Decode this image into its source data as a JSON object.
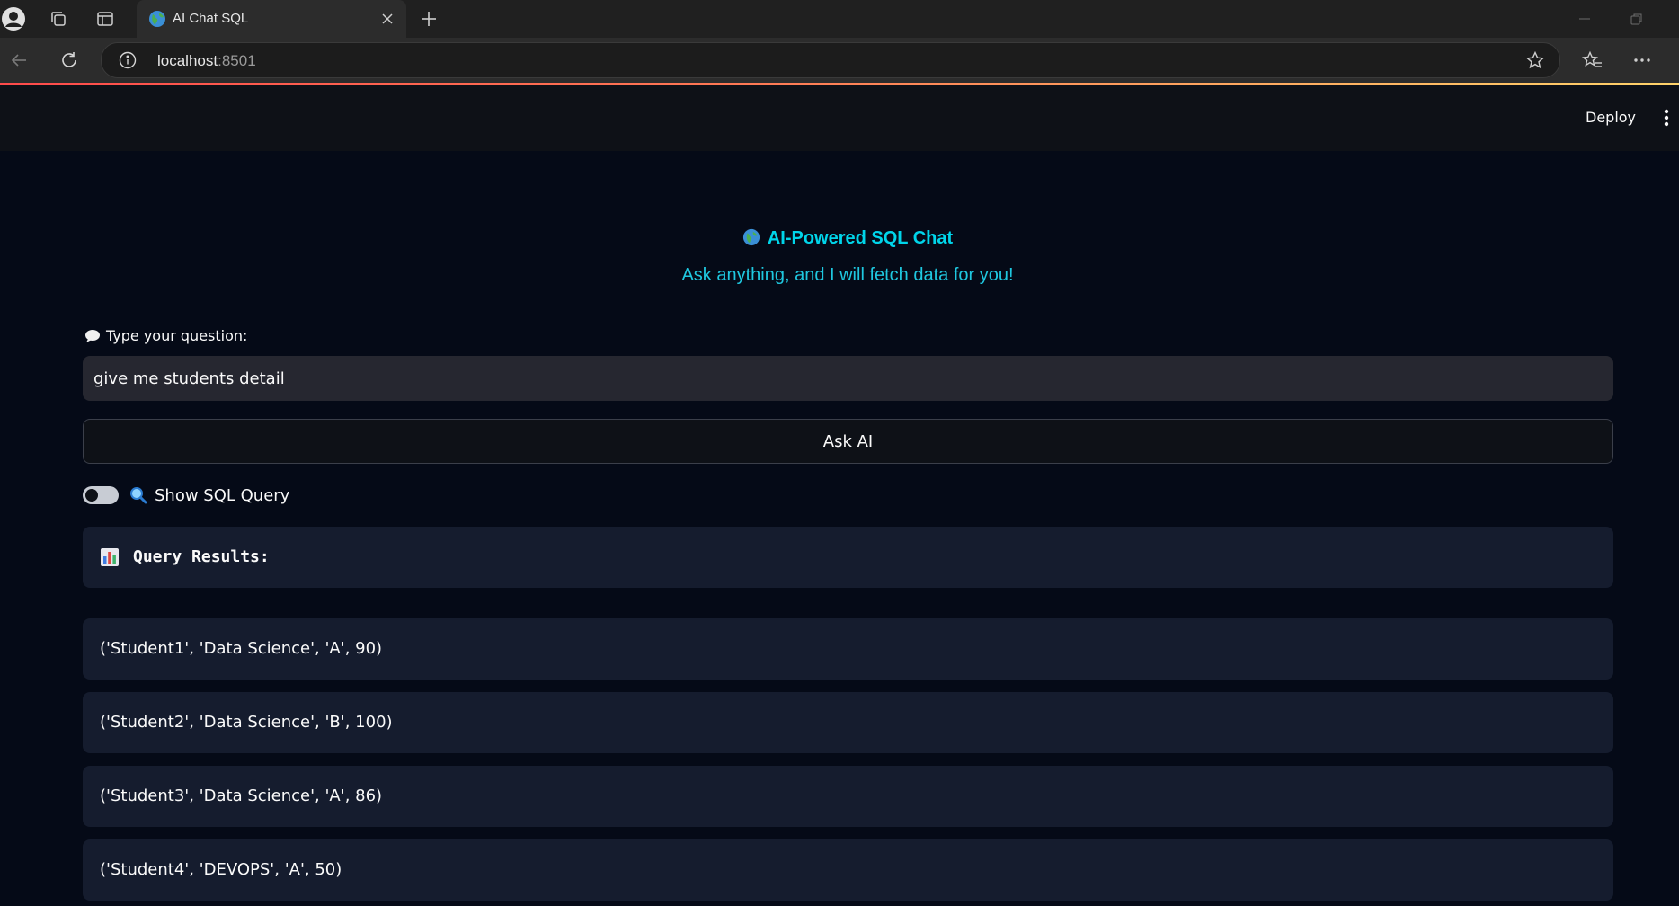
{
  "browser": {
    "tab_title": "AI Chat SQL",
    "url_host": "localhost",
    "url_port": ":8501"
  },
  "header": {
    "deploy_label": "Deploy"
  },
  "app": {
    "title": "AI-Powered SQL Chat",
    "subtitle": "Ask anything, and I will fetch data for you!",
    "question_label": "Type your question:",
    "question_value": "give me students detail",
    "ask_button": "Ask AI",
    "toggle_label": "Show SQL Query",
    "toggle_on": false,
    "results_header": "Query Results:",
    "results": [
      "('Student1', 'Data Science', 'A', 90)",
      "('Student2', 'Data Science', 'B', 100)",
      "('Student3', 'Data Science', 'A', 86)",
      "('Student4', 'DEVOPS', 'A', 50)"
    ]
  },
  "colors": {
    "accent_title": "#00d5ea",
    "background": "#050a17",
    "card": "#151c2e"
  },
  "icons": [
    "profile-icon",
    "collections-icon",
    "tab-actions-icon",
    "globe-icon",
    "close-icon",
    "new-tab-icon",
    "back-icon",
    "refresh-icon",
    "info-icon",
    "star-icon",
    "favorites-icon",
    "more-icon",
    "kebab-menu-icon",
    "speech-bubble-icon",
    "magnifier-icon",
    "bar-chart-icon"
  ]
}
